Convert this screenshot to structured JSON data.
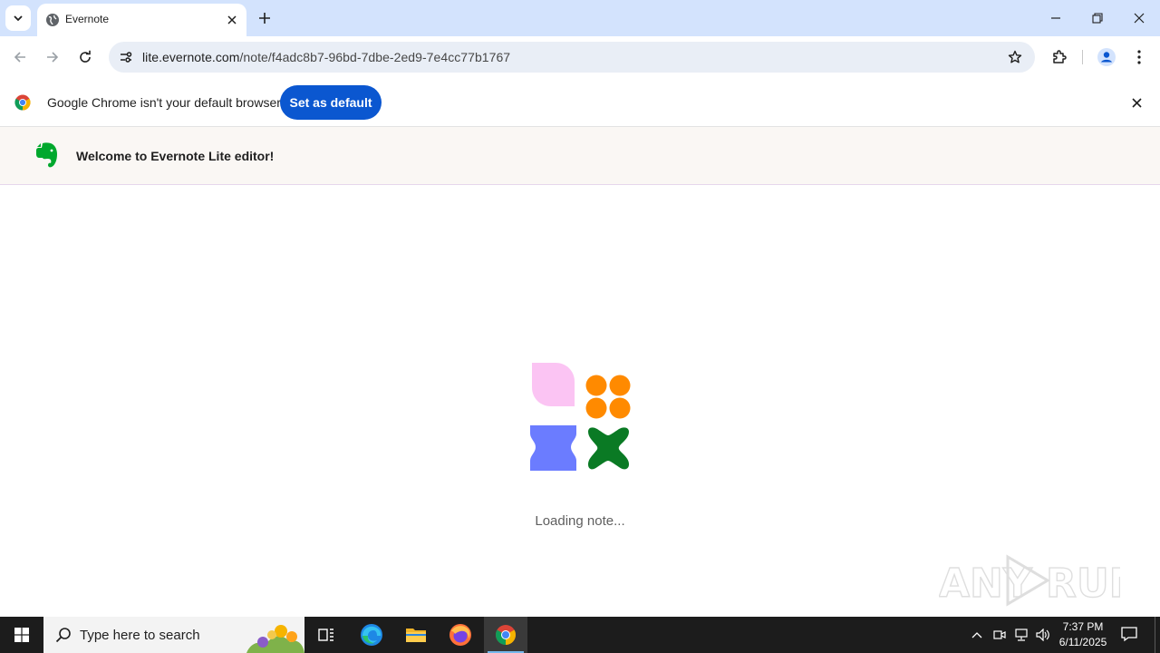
{
  "browser": {
    "tab": {
      "title": "Evernote"
    },
    "omnibox": {
      "host": "lite.evernote.com",
      "path": "/note/f4adc8b7-96bd-7dbe-2ed9-7e4cc77b1767"
    },
    "icons": [
      "tab-search-icon",
      "globe-icon",
      "close-icon",
      "plus-icon",
      "minimize-icon",
      "restore-icon",
      "back-icon",
      "forward-icon",
      "reload-icon",
      "site-info-icon",
      "star-icon",
      "extensions-icon",
      "profile-icon",
      "menu-icon"
    ]
  },
  "infobar": {
    "message": "Google Chrome isn't your default browser",
    "button_label": "Set as default"
  },
  "page": {
    "welcome_text": "Welcome to Evernote Lite editor!",
    "loading_text": "Loading note...",
    "loader_colors": {
      "pink": "#fbc4f3",
      "orange": "#ff8a00",
      "blue": "#6b7cff",
      "green": "#0a7a24"
    },
    "brand_color": "#00a82d",
    "watermark_text": "ANY RUN"
  },
  "taskbar": {
    "search_placeholder": "Type here to search",
    "clock_time": "7:37 PM",
    "clock_date": "6/11/2025",
    "apps": [
      "task-view",
      "edge",
      "file-explorer",
      "firefox",
      "chrome"
    ],
    "accent": "#76b9ed"
  }
}
